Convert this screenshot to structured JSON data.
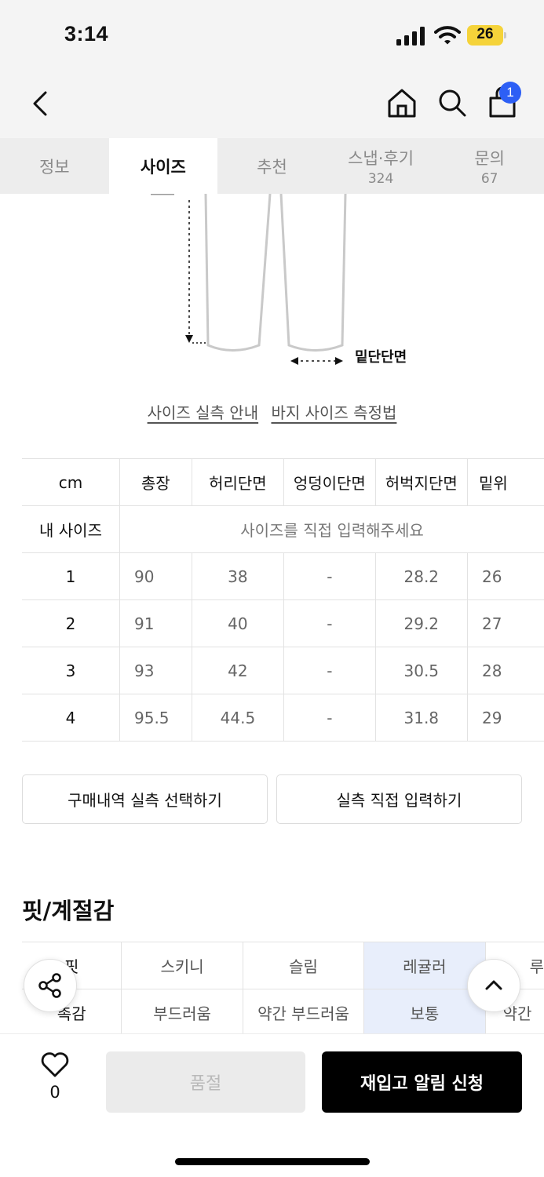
{
  "status_bar": {
    "time": "3:14",
    "battery": "26"
  },
  "nav": {
    "cart_count": "1"
  },
  "tabs": [
    {
      "label": "정보",
      "count": ""
    },
    {
      "label": "사이즈",
      "count": ""
    },
    {
      "label": "추천",
      "count": ""
    },
    {
      "label": "스냅·후기",
      "count": "324"
    },
    {
      "label": "문의",
      "count": "67"
    }
  ],
  "diagram": {
    "measure_label": "밑단단면"
  },
  "links": {
    "size_guide": "사이즈 실측 안내",
    "measure_method": "바지 사이즈 측정법"
  },
  "size_table": {
    "headers": [
      "cm",
      "총장",
      "허리단면",
      "엉덩이단면",
      "허벅지단면",
      "밑위"
    ],
    "my_size_label": "내 사이즈",
    "my_size_hint": "사이즈를 직접 입력해주세요",
    "rows": [
      {
        "size": "1",
        "total": "90",
        "waist": "38",
        "hip": "-",
        "thigh": "28.2",
        "rise": "26"
      },
      {
        "size": "2",
        "total": "91",
        "waist": "40",
        "hip": "-",
        "thigh": "29.2",
        "rise": "27"
      },
      {
        "size": "3",
        "total": "93",
        "waist": "42",
        "hip": "-",
        "thigh": "30.5",
        "rise": "28"
      },
      {
        "size": "4",
        "total": "95.5",
        "waist": "44.5",
        "hip": "-",
        "thigh": "31.8",
        "rise": "29"
      }
    ]
  },
  "buttons": {
    "select_purchase": "구매내역 실측 선택하기",
    "direct_input": "실측 직접 입력하기"
  },
  "fit": {
    "title": "핏/계절감",
    "rows": [
      {
        "label": "핏",
        "options": [
          "스키니",
          "슬림",
          "레귤러",
          "루"
        ],
        "selected": 2
      },
      {
        "label": "촉감",
        "options": [
          "부드러움",
          "약간 부드러움",
          "보통",
          "약간"
        ],
        "selected": 2
      }
    ]
  },
  "bottom": {
    "like_count": "0",
    "soldout_label": "품절",
    "notify_label": "재입고 알림 신청"
  },
  "colors": {
    "accent": "#2d5ff5",
    "selected_cell": "#e8eefb",
    "battery": "#f5d33a"
  }
}
